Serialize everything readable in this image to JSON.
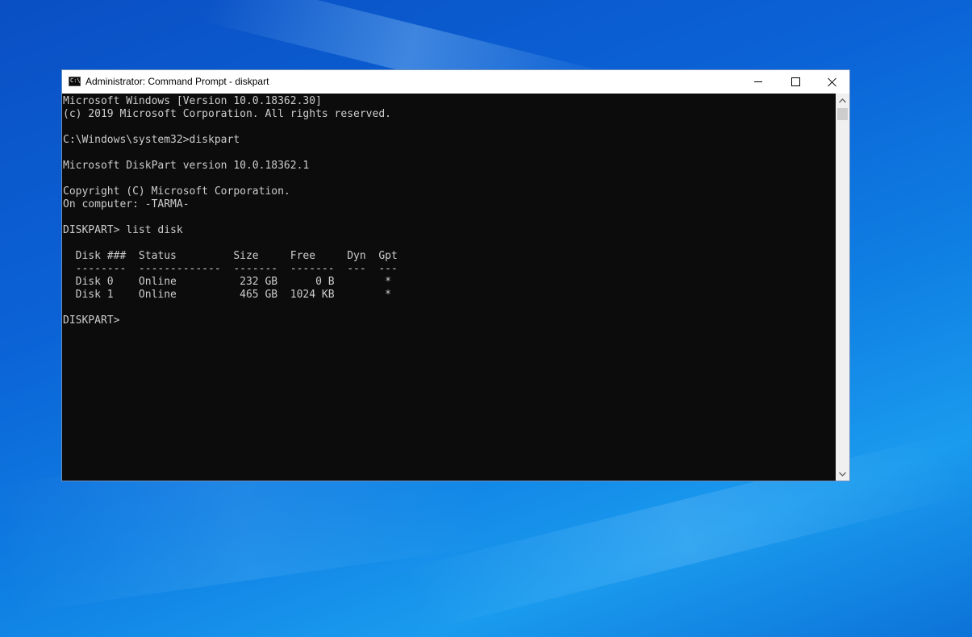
{
  "window": {
    "title": "Administrator: Command Prompt - diskpart",
    "icon_label": "C:\\",
    "controls": {
      "minimize": "minimize",
      "maximize": "maximize",
      "close": "close"
    }
  },
  "console": {
    "lines": [
      "Microsoft Windows [Version 10.0.18362.30]",
      "(c) 2019 Microsoft Corporation. All rights reserved.",
      "",
      "C:\\Windows\\system32>diskpart",
      "",
      "Microsoft DiskPart version 10.0.18362.1",
      "",
      "Copyright (C) Microsoft Corporation.",
      "On computer: -TARMA-",
      "",
      "DISKPART> list disk",
      "",
      "  Disk ###  Status         Size     Free     Dyn  Gpt",
      "  --------  -------------  -------  -------  ---  ---",
      "  Disk 0    Online          232 GB      0 B        *",
      "  Disk 1    Online          465 GB  1024 KB        *",
      "",
      "DISKPART> "
    ]
  },
  "colors": {
    "console_bg": "#0c0c0c",
    "console_fg": "#cccccc",
    "titlebar_bg": "#ffffff",
    "desktop_blue": "#0b63d6"
  }
}
